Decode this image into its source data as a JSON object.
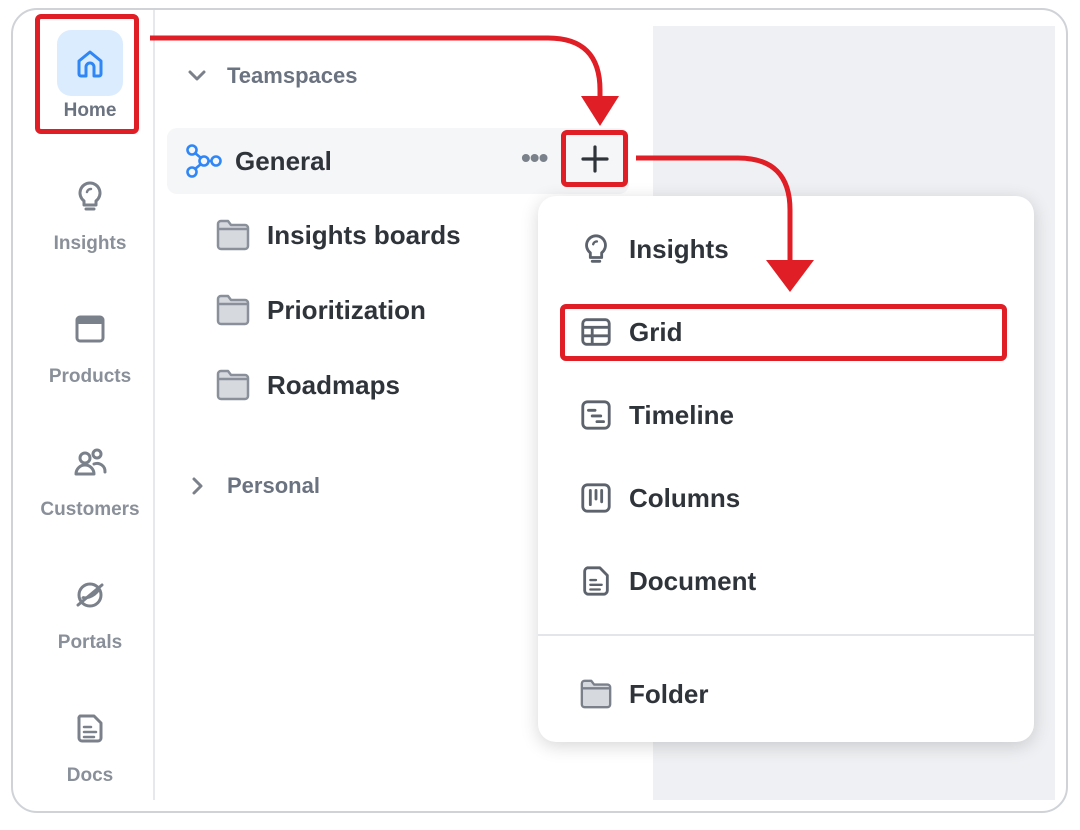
{
  "sidebar": {
    "items": [
      {
        "label": "Home",
        "icon": "home-icon",
        "active": true
      },
      {
        "label": "Insights",
        "icon": "lightbulb-icon"
      },
      {
        "label": "Products",
        "icon": "window-icon"
      },
      {
        "label": "Customers",
        "icon": "customers-icon"
      },
      {
        "label": "Portals",
        "icon": "portal-icon"
      },
      {
        "label": "Docs",
        "icon": "doc-icon"
      }
    ]
  },
  "panel": {
    "teamspaces_label": "Teamspaces",
    "team": {
      "name": "General",
      "more_label": "•••",
      "add_label": "+"
    },
    "folders": [
      "Insights boards",
      "Prioritization",
      "Roadmaps"
    ],
    "personal_label": "Personal"
  },
  "add_menu": {
    "items": [
      {
        "label": "Insights",
        "icon": "lightbulb-icon"
      },
      {
        "label": "Grid",
        "icon": "grid-icon",
        "highlighted": true
      },
      {
        "label": "Timeline",
        "icon": "timeline-icon"
      },
      {
        "label": "Columns",
        "icon": "columns-icon"
      },
      {
        "label": "Document",
        "icon": "document-icon"
      }
    ],
    "folder_item": {
      "label": "Folder",
      "icon": "folder-icon"
    }
  },
  "colors": {
    "highlight": "#e01e26",
    "accent": "#2f86f6",
    "active_bg": "#dcecff"
  }
}
